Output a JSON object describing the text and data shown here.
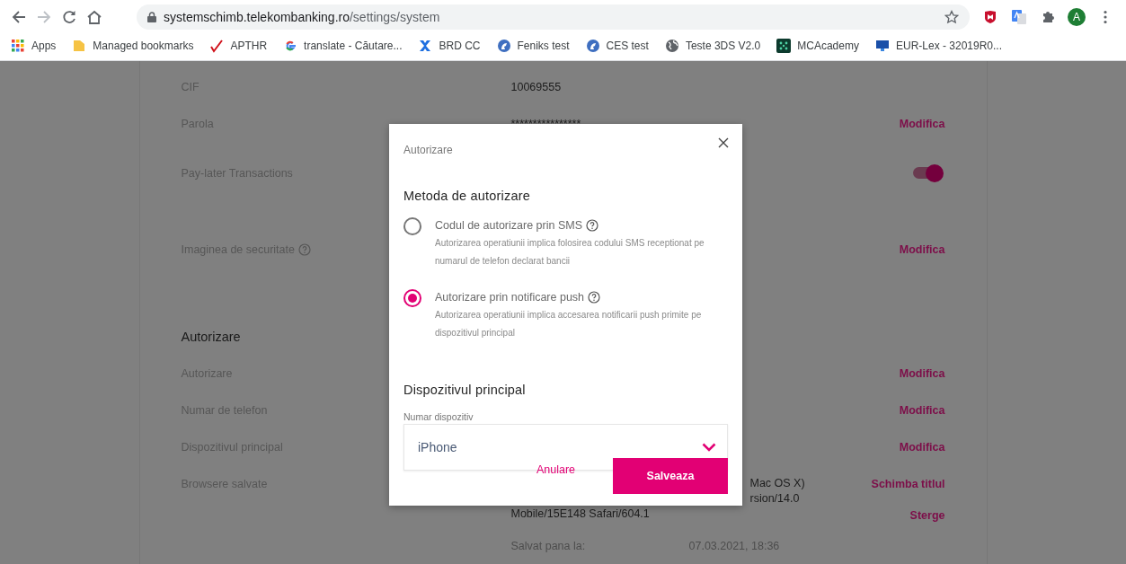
{
  "browser": {
    "url_host": "systemschimb.telekombanking.ro",
    "url_path": "/settings/system",
    "profile_initial": "A",
    "bookmarks": [
      {
        "label": "Apps"
      },
      {
        "label": "Managed bookmarks"
      },
      {
        "label": "APTHR"
      },
      {
        "label": "translate - Căutare..."
      },
      {
        "label": "BRD CC"
      },
      {
        "label": "Feniks test"
      },
      {
        "label": "CES test"
      },
      {
        "label": "Teste 3DS V2.0"
      },
      {
        "label": "MCAcademy"
      },
      {
        "label": "EUR-Lex - 32019R0..."
      }
    ]
  },
  "settings": {
    "rows": [
      {
        "kind": "field",
        "label": "CIF",
        "value": "10069555"
      },
      {
        "kind": "password",
        "label": "Parola",
        "value": "****************",
        "action": "Modifica"
      },
      {
        "kind": "toggle",
        "label": "Pay-later Transactions",
        "on": true
      },
      {
        "kind": "image",
        "label": "Imaginea de securitate",
        "action": "Modifica"
      },
      {
        "kind": "heading",
        "label": "Autorizare"
      },
      {
        "kind": "field",
        "label": "Autorizare",
        "action": "Modifica"
      },
      {
        "kind": "field",
        "label": "Numar de telefon",
        "action": "Modifica"
      },
      {
        "kind": "field",
        "label": "Dispozitivul principal",
        "action": "Modifica"
      },
      {
        "kind": "browser",
        "label": "Browsere salvate",
        "value_lines": [
          "Mac OS X)",
          "rsion/14.0",
          "Mobile/15E148 Safari/604.1"
        ],
        "actions": [
          "Schimba titlul",
          "Sterge"
        ],
        "details": [
          {
            "label": "Salvat pana la:",
            "value": "07.03.2021, 18:36"
          }
        ]
      }
    ]
  },
  "modal": {
    "title": "Autorizare",
    "method_heading": "Metoda de autorizare",
    "options": [
      {
        "label": "Codul de autorizare prin SMS",
        "description": "Autorizarea operatiunii implica folosirea codului SMS receptionat pe numarul de telefon declarat bancii",
        "selected": false
      },
      {
        "label": "Autorizare prin notificare push",
        "description": "Autorizarea operatiunii implica accesarea notificarii push primite pe dispozitivul principal",
        "selected": true
      }
    ],
    "device_heading": "Dispozitivul principal",
    "device_label": "Numar dispozitiv",
    "device_value": "iPhone",
    "cancel": "Anulare",
    "save": "Salveaza"
  }
}
